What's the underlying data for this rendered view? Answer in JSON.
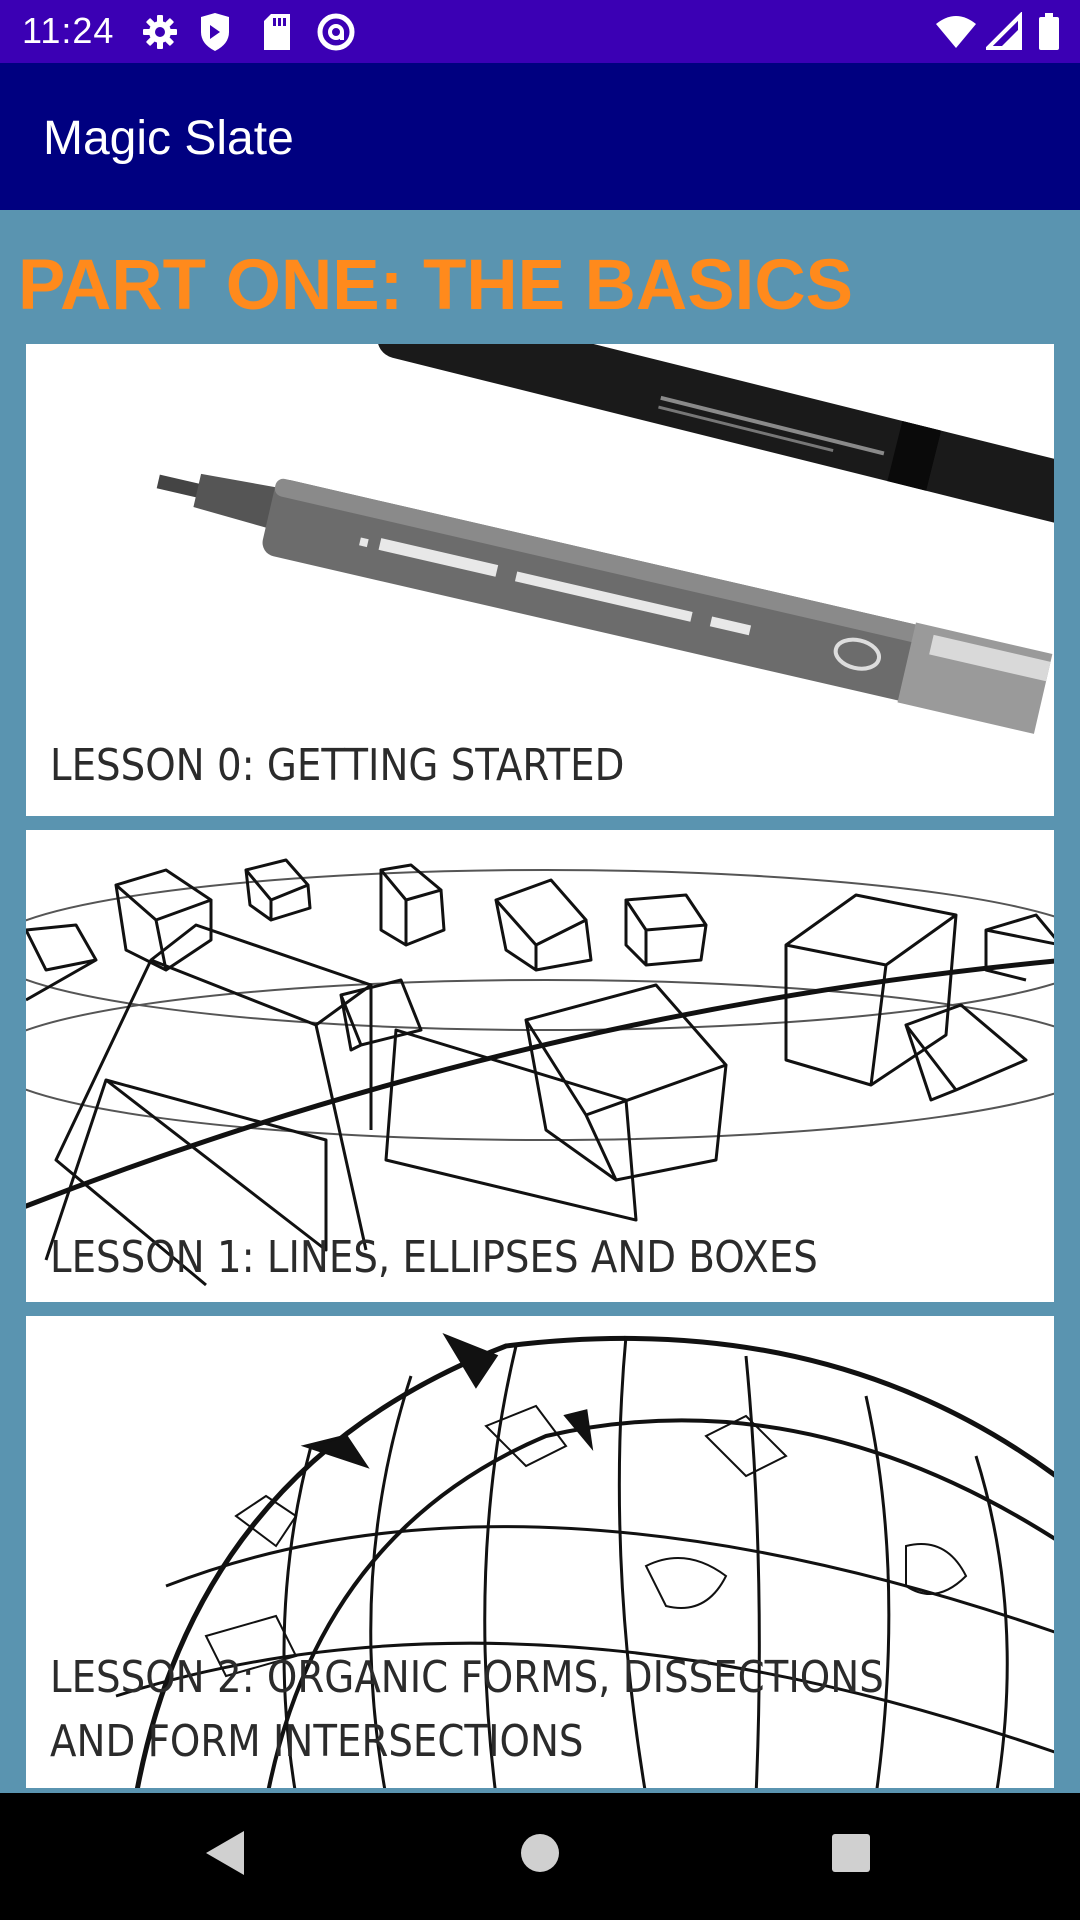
{
  "status_bar": {
    "time": "11:24",
    "left_icons": [
      "gear-icon",
      "shield-icon",
      "sd-card-icon",
      "at-sign-icon"
    ],
    "right_icons": [
      "wifi-icon",
      "signal-icon",
      "battery-icon"
    ]
  },
  "app_bar": {
    "title": "Magic Slate",
    "background": "#000080"
  },
  "section": {
    "heading": "PART ONE: THE BASICS",
    "color": "#ff8a1c"
  },
  "lessons": [
    {
      "label": "LESSON 0: GETTING STARTED",
      "image": "pens-image"
    },
    {
      "label": "LESSON 1: LINES, ELLIPSES AND BOXES",
      "image": "boxes-sketch-image"
    },
    {
      "label": "LESSON 2: ORGANIC FORMS, DISSECTIONS\nAND FORM INTERSECTIONS",
      "image": "organic-form-sketch-image"
    }
  ],
  "nav_bar": {
    "icons": [
      "back-icon",
      "home-icon",
      "recents-icon"
    ]
  },
  "colors": {
    "status_bar": "#3b00b4",
    "page_background": "#5a94b0"
  }
}
